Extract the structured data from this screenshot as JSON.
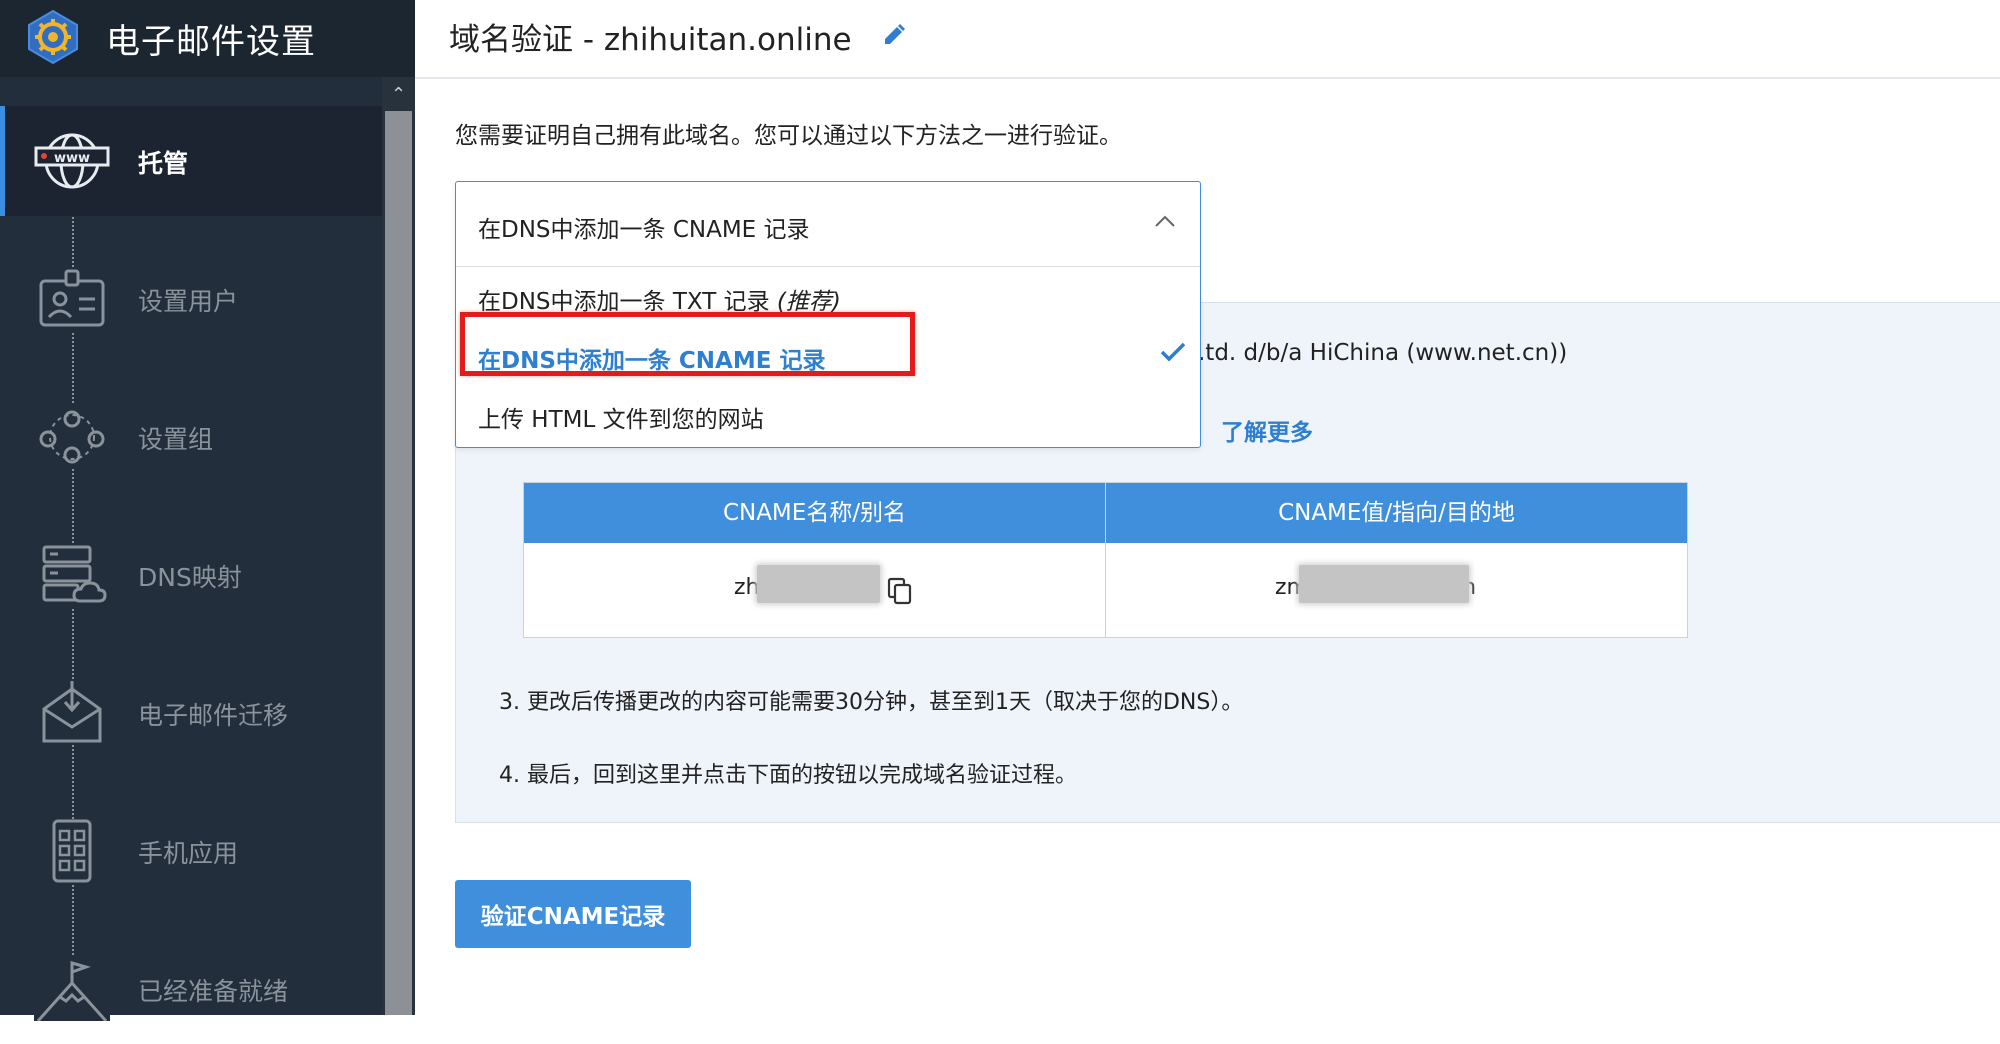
{
  "sidebar": {
    "app_title": "电子邮件设置",
    "items": [
      {
        "label": "托管",
        "icon": "globe-www-icon",
        "active": true
      },
      {
        "label": "设置用户",
        "icon": "user-card-icon"
      },
      {
        "label": "设置组",
        "icon": "group-icon"
      },
      {
        "label": "DNS映射",
        "icon": "server-cloud-icon"
      },
      {
        "label": "电子邮件迁移",
        "icon": "mail-migration-icon"
      },
      {
        "label": "手机应用",
        "icon": "mobile-app-icon"
      },
      {
        "label": "已经准备就绪",
        "icon": "mountain-flag-icon"
      }
    ]
  },
  "header": {
    "title": "域名验证 - zhihuitan.online"
  },
  "main": {
    "intro": "您需要证明自己拥有此域名。您可以通过以下方法之一进行验证。",
    "dropdown": {
      "selected": "在DNS中添加一条 CNAME 记录",
      "options": [
        {
          "label": "在DNS中添加一条 TXT 记录",
          "tag": "(推荐)"
        },
        {
          "label": "在DNS中添加一条 CNAME 记录",
          "selected": true
        },
        {
          "label": "上传 HTML 文件到您的网站"
        }
      ]
    },
    "provider_text": ".td. d/b/a HiChina (www.net.cn))",
    "learn_more": "了解更多",
    "table": {
      "headers": [
        "CNAME名称/别名",
        "CNAME值/指向/目的地"
      ],
      "row": {
        "name_visible_prefix": "zh",
        "value_visible_prefix": "zm",
        "value_visible_suffix": ".cn"
      }
    },
    "steps": {
      "step3": "3. 更改后传播更改的内容可能需要30分钟，甚至到1天（取决于您的DNS）。",
      "step4": "4. 最后，回到这里并点击下面的按钮以完成域名验证过程。"
    },
    "verify_button": "验证CNAME记录"
  },
  "colors": {
    "sidebar_bg": "#222e3c",
    "accent": "#3f8fdc",
    "highlight": "#e31b1b",
    "panel_bg": "#eff4fa"
  }
}
